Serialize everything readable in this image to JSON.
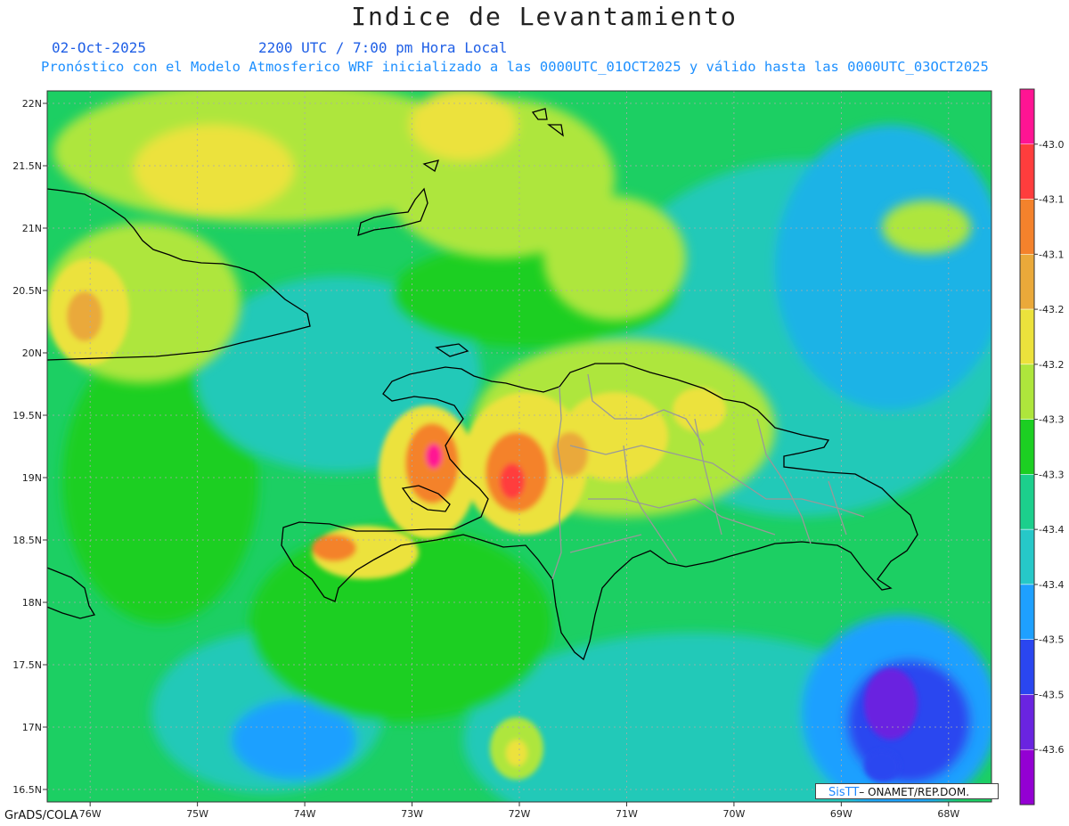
{
  "header": {
    "title": "Indice de Levantamiento",
    "date": "02-Oct-2025",
    "time": "2200 UTC / 7:00 pm Hora Local",
    "description": "Pronóstico con el Modelo Atmosferico WRF inicializado a las 0000UTC_01OCT2025 y válido hasta las  0000UTC_03OCT2025"
  },
  "map": {
    "lon_range": [
      -76.4,
      -67.6
    ],
    "lat_range": [
      16.4,
      22.1
    ],
    "lat_ticks": [
      "22N",
      "21.5N",
      "21N",
      "20.5N",
      "20N",
      "19.5N",
      "19N",
      "18.5N",
      "18N",
      "17.5N",
      "17N",
      "16.5N"
    ],
    "lon_ticks": [
      "76W",
      "75W",
      "74W",
      "73W",
      "72W",
      "71W",
      "70W",
      "69W",
      "68W"
    ],
    "features": [
      {
        "name": "Hispaniola (Haiti / Republica Dominicana)",
        "type": "coastline"
      },
      {
        "name": "Cuba oriental",
        "type": "coastline"
      },
      {
        "name": "Islas Turcas y Caicos",
        "type": "coastline"
      },
      {
        "name": "Jamaica",
        "type": "coastline"
      }
    ],
    "colors": {
      "background_field": "#1ccf63",
      "coast": "#000000",
      "provinces": "#999999"
    }
  },
  "colorbar": {
    "labels": [
      "-43.0",
      "-43.1",
      "-43.1",
      "-43.2",
      "-43.2",
      "-43.3",
      "-43.3",
      "-43.4",
      "-43.4",
      "-43.5",
      "-43.5",
      "-43.6"
    ],
    "colors": [
      "#ff1493",
      "#ff3d3d",
      "#f4822c",
      "#eaa93a",
      "#ece23c",
      "#aee63c",
      "#1ccf22",
      "#1ccf8c",
      "#26c8c8",
      "#1ea0ff",
      "#2a46f0",
      "#6a24e0",
      "#9400d3"
    ]
  },
  "footer": {
    "left": "GrADS/COLA",
    "stamp_brand": "SisTT",
    "stamp_text": "– ONAMET/REP.DOM."
  }
}
